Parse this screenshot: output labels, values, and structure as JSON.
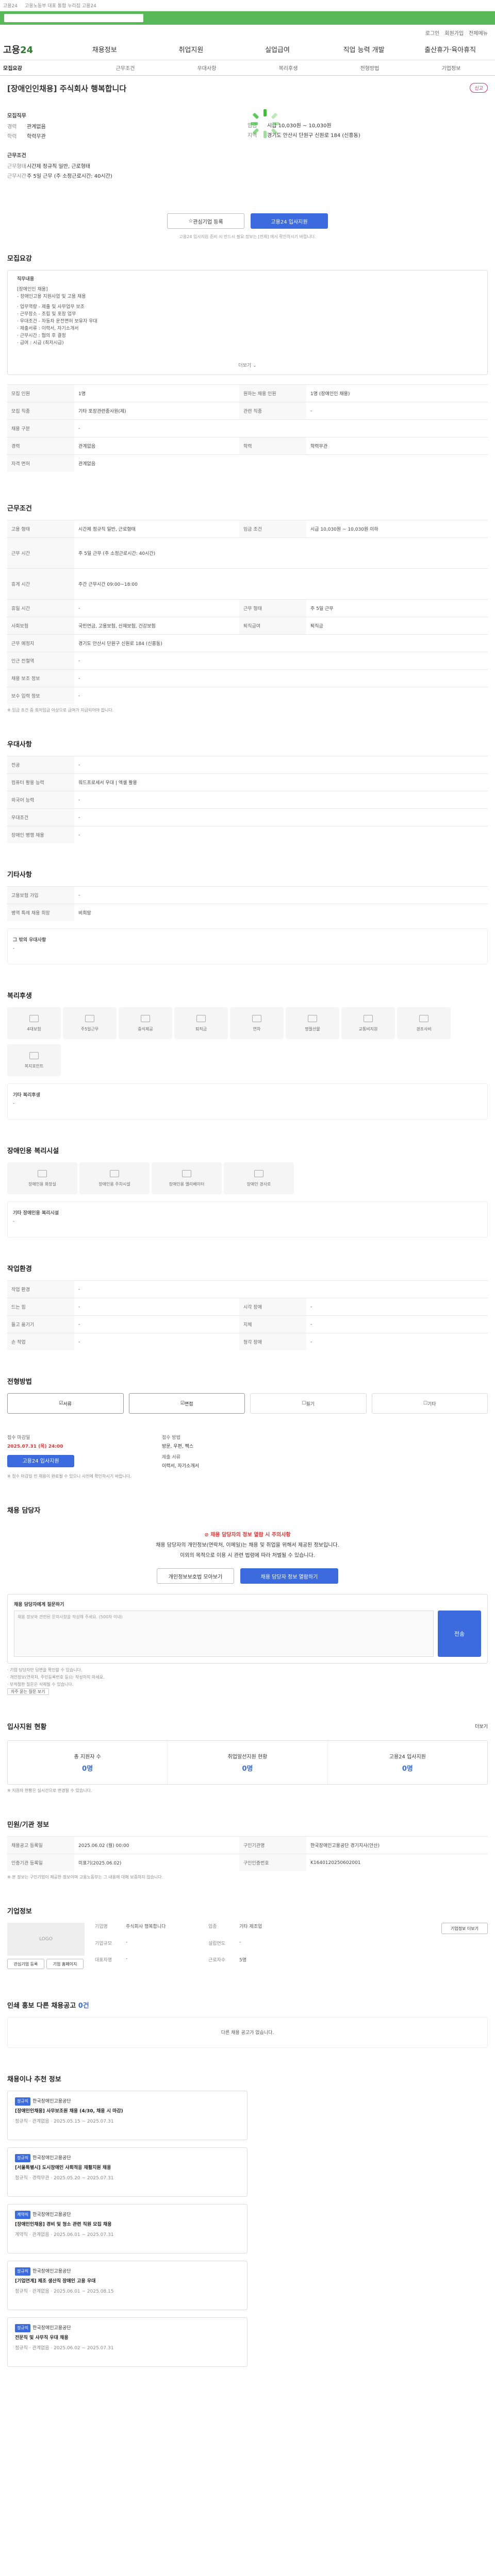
{
  "top": {
    "left": "고용24",
    "notice": "고용노동부 대표 통합 누리집 고용24"
  },
  "util": [
    "로그인",
    "회원가입",
    "전체메뉴"
  ],
  "nav": {
    "logo_a": "고용",
    "logo_b": "24",
    "items": [
      "채용정보",
      "취업지원",
      "실업급여",
      "직업 능력 개발",
      "출산휴가·육아휴직"
    ]
  },
  "tabs": [
    "모집요강",
    "근무조건",
    "우대사항",
    "복리후생",
    "전형방법",
    "기업정보"
  ],
  "job": {
    "title": "[장애인인채용] 주식회사 행복합니다",
    "report": "신고",
    "col1": [
      {
        "k": "경력",
        "v": "관계없음"
      },
      {
        "k": "학력",
        "v": "학력무관"
      }
    ],
    "col2": [
      {
        "k": "임금",
        "v": "시급 10,030원 ~ 10,030원"
      },
      {
        "k": "지역",
        "v": "경기도 안산시 단원구 신원로 184 (신흥동)"
      }
    ],
    "col1b": [
      {
        "k": "근무형태",
        "v": "시간제 정규직 일반, 근로형태"
      },
      {
        "k": "근무시간",
        "v": "주 5일 근무 (주 소정근로시간: 40시간)"
      }
    ],
    "recruit_label": "모집직무",
    "condition_label": "근무조건"
  },
  "buttons": {
    "interest": "관심기업 등록",
    "apply": "고용24 입사지원"
  },
  "notice_line": "고용24 입사지원 준비 시 반드시 필요 정보는 [전체] 에서 확인하시기 바랍니다.",
  "recruit": {
    "title": "모집요강",
    "desc": [
      "직무내용",
      "[장애인인 채용]",
      "- 장애인고용 지원사업 및 고용 채용",
      " · 업무역량 - 제출 및 사무업무 보조",
      " · 근무장소 - 조립 및 포장 업무",
      " · 우대조건 - 자동차 운전면허 보유자 우대",
      " · 제출서류 : 이력서, 자기소개서",
      " · 근무시간 : 협의 후 결정",
      " · 급여 : 시급 (최저시급)"
    ],
    "more": "더보기",
    "rows": [
      [
        "모집 인원",
        "1명",
        "원하는 채용 인원",
        "1명 (장애인인 채용)"
      ],
      [
        "모집 직종",
        "기타 포장관련종사원(제)",
        "관련 직종",
        "-"
      ],
      [
        "채용 구분",
        "-",
        "",
        ""
      ],
      [
        "경력",
        "관계없음",
        "학력",
        "학력무관"
      ],
      [
        "자격 면허",
        "관계없음",
        "",
        ""
      ]
    ]
  },
  "cond": {
    "title": "근무조건",
    "rows": [
      [
        "고용 형태",
        "시간제 정규직 일반, 근로형태",
        "임금 조건",
        "시급 10,030원 ~ 10,030원 이하"
      ],
      [
        "근무 시간",
        "주 5일 근무 (주 소정근로시간: 40시간)",
        "",
        ""
      ],
      [
        "휴게 시간",
        "주간 근무시간 09:00~18:00",
        "",
        ""
      ],
      [
        "휴일 시간",
        "-",
        "근무 형태",
        "주 5일 근무"
      ],
      [
        "사회보험",
        "국민연금, 고용보험, 산재보험, 건강보험",
        "퇴직급여",
        "퇴직금"
      ],
      [
        "근무 예정지",
        "경기도 안산시 단원구 신원로 184 (신흥동)",
        "",
        ""
      ],
      [
        "인근 전철역",
        "-",
        "",
        ""
      ],
      [
        "채용 보조 정보",
        "-",
        "",
        ""
      ],
      [
        "보수 입력 정보",
        "-",
        "",
        ""
      ]
    ],
    "caption": "※ 임금 조건 중 최저임금 이상으로 급여가 지급되어야 합니다."
  },
  "pref": {
    "title": "우대사항",
    "rows": [
      [
        "전공",
        "-"
      ],
      [
        "컴퓨터 활용 능력",
        "워드프로세서 우대 | 엑셀 활용"
      ],
      [
        "외국어 능력",
        "-"
      ],
      [
        "우대조건",
        "-"
      ],
      [
        "장애인 병행 채용",
        "-"
      ]
    ]
  },
  "etc": {
    "title": "기타사항",
    "rows": [
      [
        "고용보험 가입",
        "-"
      ],
      [
        "병역 특례 채용 희망",
        "비희망"
      ]
    ],
    "extra_label": "그 밖의 우대사항",
    "extra_val": "-"
  },
  "welfare": {
    "title": "복리후생",
    "items": [
      "4대보험",
      "주5일근무",
      "중식제공",
      "퇴직금",
      "연차",
      "명절선물",
      "교통비지원",
      "경조사비",
      "복지포인트"
    ],
    "other_label": "기타 복리후생",
    "other_val": "-"
  },
  "disability": {
    "title": "장애인용 복리시설",
    "items": [
      "장애인용 화장실",
      "장애인용 주차시설",
      "장애인용 엘리베이터",
      "장애인 경사로"
    ],
    "other_label": "기타 장애인용 복리시설",
    "other_val": "-"
  },
  "environment": {
    "title": "작업환경",
    "rows": [
      [
        "작업 환경",
        "-",
        "",
        ""
      ],
      [
        "드는 힘",
        "-",
        "시각 장애",
        "-"
      ],
      [
        "들고 옮기기",
        "-",
        "지체",
        "-"
      ],
      [
        "손 작업",
        "-",
        "청각 장애",
        "-"
      ]
    ]
  },
  "selection": {
    "title": "전형방법",
    "steps": [
      "서류",
      "면접",
      "필기",
      "기타"
    ]
  },
  "apply": {
    "title": "접수 마감일",
    "deadline_label": "접수 마감일",
    "deadline": "2025.07.31 (목) 24:00",
    "method_label": "접수 방법",
    "method": "방문, 우편, 팩스",
    "docs_label": "제출 서류",
    "docs": "이력서, 자기소개서",
    "btn": "고용24 입사지원",
    "caption": "※ 접수 마감일 전 채용이 완료될 수 있으니 사전에 확인하시기 바랍니다."
  },
  "manager": {
    "title": "채용 담당자",
    "warn1": "채용 담당자의 정보 열람 시 주의사항",
    "warn2": "채용 담당자의 개인정보(연락처, 이메일)는 채용 및 취업을 위해서 제공된 정보입니다.",
    "warn3": "이외의 목적으로 이용 시 관련 법령에 따라 처벌될 수 있습니다.",
    "btn_left": "개인정보보호법 모아보기",
    "btn_right": "채용 담당자 정보 열람하기"
  },
  "question": {
    "title": "채용 담당자에게 질문하기",
    "placeholder": "채용 정보와 관련된 문의사항을 작성해 주세요. (500자 이내)",
    "btn": "전송",
    "notes": [
      "· 기업 담당자만 답변을 확인할 수 있습니다.",
      "· 개인정보(연락처, 주민등록번호 등)는 작성하지 마세요.",
      "· 부적절한 질문은 삭제될 수 있습니다."
    ],
    "link": "자주 묻는 질문 보기"
  },
  "status": {
    "title": "입사지원 현황",
    "more": "더보기",
    "items": [
      {
        "k": "총 지원자 수",
        "v": "0명"
      },
      {
        "k": "취업알선지원 현황",
        "v": "0명"
      },
      {
        "k": "고용24 입사지원",
        "v": "0명"
      }
    ],
    "caption": "※ 지원자 현황은 실시간으로 변경될 수 있습니다."
  },
  "info": {
    "title": "민원/기관 정보",
    "rows": [
      [
        "채용공고 등록일",
        "2025.06.02 (월) 00:00",
        "구인기관명",
        "한국장애인고용공단 경기지사(안산)"
      ],
      [
        "인증기관 등록일",
        "미표기(2025.06.02)",
        "구인인증번호",
        "K1640120250602001"
      ]
    ],
    "caption": "※ 본 정보는 구인기업이 제공한 정보이며 고용노동부는 그 내용에 대해 보증하지 않습니다."
  },
  "company": {
    "title": "기업정보",
    "logo": "LOGO",
    "rows": [
      [
        "기업명",
        "주식회사 행복합니다"
      ],
      [
        "업종",
        "기타 제조업"
      ],
      [
        "기업규모",
        "-"
      ],
      [
        "설립연도",
        "-"
      ],
      [
        "대표자명",
        "-"
      ],
      [
        "근로자수",
        "5명"
      ]
    ],
    "btn": "기업정보 더보기",
    "sub_btns": [
      "관심기업 등록",
      "기업 홈페이지"
    ]
  },
  "nearby": {
    "title": "인쇄 홍보 다른 채용공고",
    "count": "0건",
    "empty": "다른 채용 공고가 없습니다."
  },
  "recommend": {
    "title": "채용이나 추천 정보",
    "cards": [
      {
        "badge": "정규직",
        "org": "한국장애인고용공단",
        "title": "[장애인인채용] 사무보조원 채용 (4/30, 채용 시 마감)",
        "sub": "정규직 · 관계없음 · 2025.05.15 ~ 2025.07.31"
      },
      {
        "badge": "정규직",
        "org": "한국장애인고용공단",
        "title": "[서울특별시] 도시장애인 사회적응 재활지원 채용",
        "sub": "정규직 · 경력무관 · 2025.05.20 ~ 2025.07.31"
      },
      {
        "badge": "계약직",
        "org": "한국장애인고용공단",
        "title": "[장애인인채용] 경비 및 청소 관련 직원 모집 채용",
        "sub": "계약직 · 관계없음 · 2025.06.01 ~ 2025.07.31"
      },
      {
        "badge": "정규직",
        "org": "한국장애인고용공단",
        "title": "[기업연계] 제조 생산직 장애인 고용 우대",
        "sub": "정규직 · 관계없음 · 2025.06.01 ~ 2025.08.15"
      },
      {
        "badge": "정규직",
        "org": "한국장애인고용공단",
        "title": "전문직 및 사무직 우대 채용",
        "sub": "정규직 · 관계없음 · 2025.06.02 ~ 2025.07.31"
      }
    ]
  }
}
